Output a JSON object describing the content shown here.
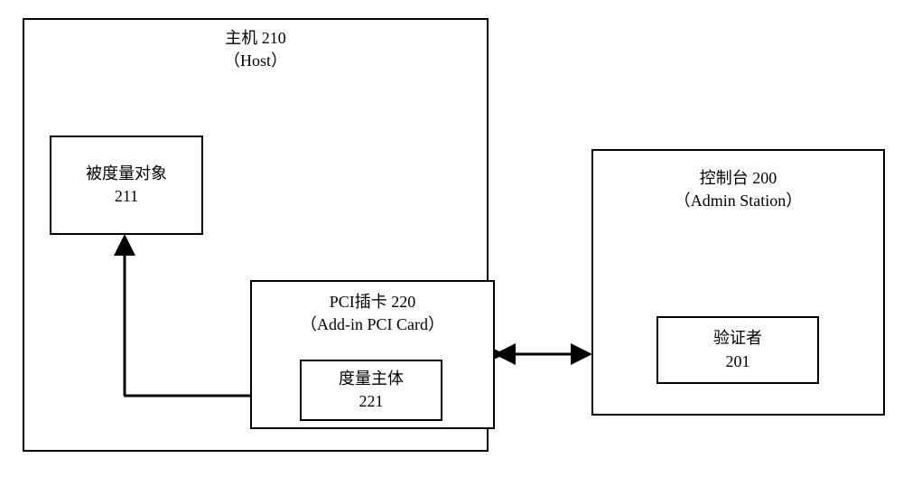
{
  "host": {
    "title_zh": "主机 210",
    "title_en": "（Host）"
  },
  "measured": {
    "title_zh": "被度量对象",
    "num": "211"
  },
  "pci": {
    "title_zh": "PCI插卡 220",
    "title_en": "（Add-in PCI Card）"
  },
  "agent": {
    "title_zh": "度量主体",
    "num": "221"
  },
  "console": {
    "title_zh": "控制台 200",
    "title_en": "（Admin Station）"
  },
  "verifier": {
    "title_zh": "验证者",
    "num": "201"
  }
}
